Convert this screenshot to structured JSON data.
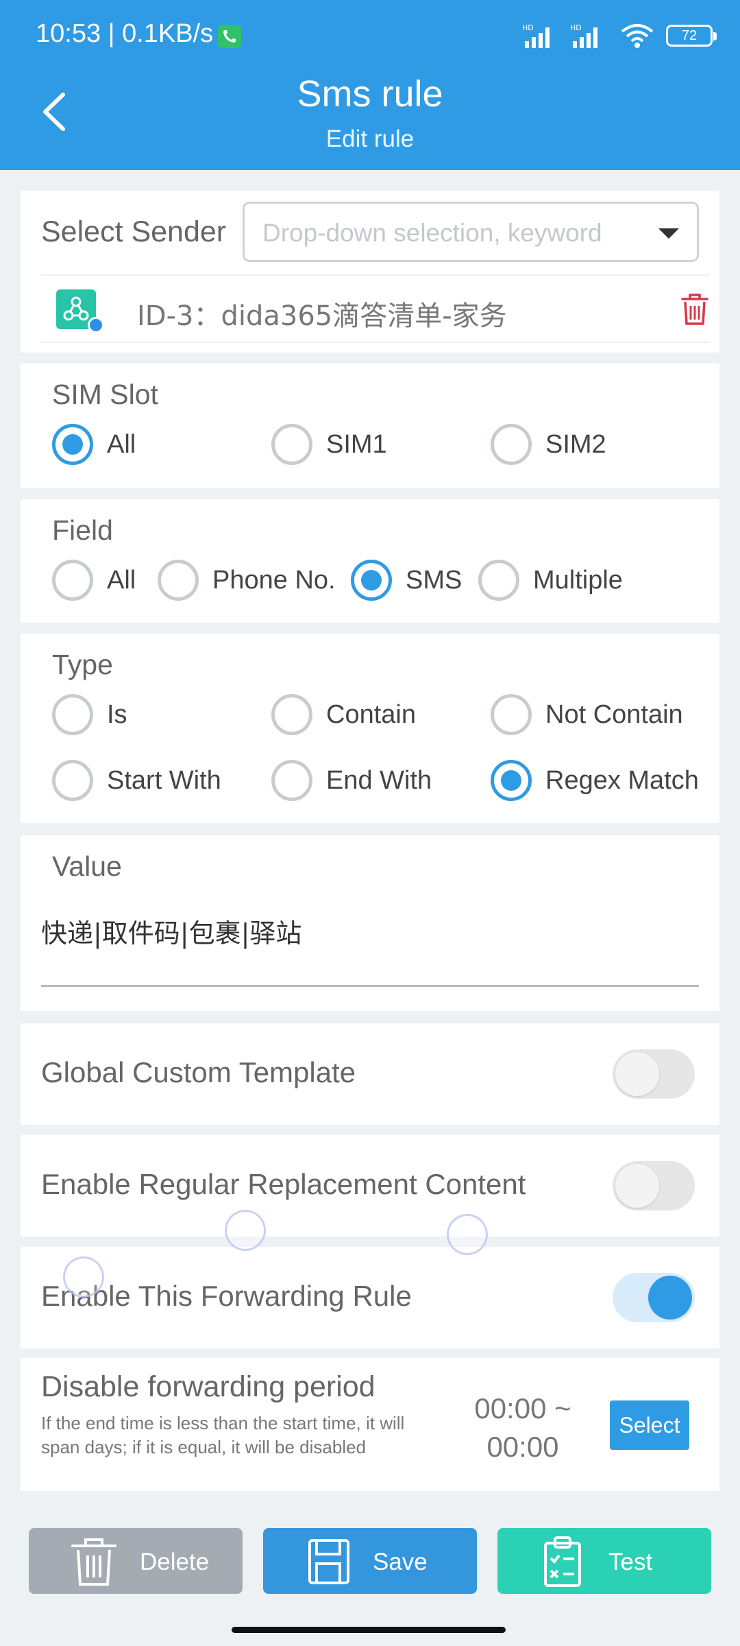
{
  "status_bar": {
    "time": "10:53 | 0.1KB/s",
    "battery": "72"
  },
  "header": {
    "title": "Sms rule",
    "subtitle": "Edit rule"
  },
  "sender": {
    "label": "Select Sender",
    "placeholder": "Drop-down selection, keyword",
    "selected": "ID-3：dida365滴答清单-家务"
  },
  "sim_slot": {
    "title": "SIM Slot",
    "options": [
      "All",
      "SIM1",
      "SIM2"
    ],
    "selected": "All"
  },
  "field": {
    "title": "Field",
    "options": [
      "All",
      "Phone No.",
      "SMS",
      "Multiple"
    ],
    "selected": "SMS"
  },
  "type": {
    "title": "Type",
    "options": [
      "Is",
      "Contain",
      "Not Contain",
      "Start With",
      "End With",
      "Regex Match"
    ],
    "selected": "Regex Match"
  },
  "value": {
    "title": "Value",
    "text": "快递|取件码|包裹|驿站"
  },
  "toggles": {
    "global_template": {
      "label": "Global Custom Template",
      "on": false
    },
    "regex_replace": {
      "label": "Enable Regular Replacement Content",
      "on": false
    },
    "enable_rule": {
      "label": "Enable This Forwarding Rule",
      "on": true
    }
  },
  "period": {
    "title": "Disable forwarding period",
    "desc": "If the end time is less than the start time, it will span days; if it is equal, it will be disabled",
    "start": "00:00 ~",
    "end": "00:00",
    "button": "Select"
  },
  "actions": {
    "delete": "Delete",
    "save": "Save",
    "test": "Test"
  },
  "colors": {
    "primary": "#2f9be4",
    "delete": "#a4abb3",
    "test": "#2bd1b4",
    "trash_red": "#d9384a"
  }
}
